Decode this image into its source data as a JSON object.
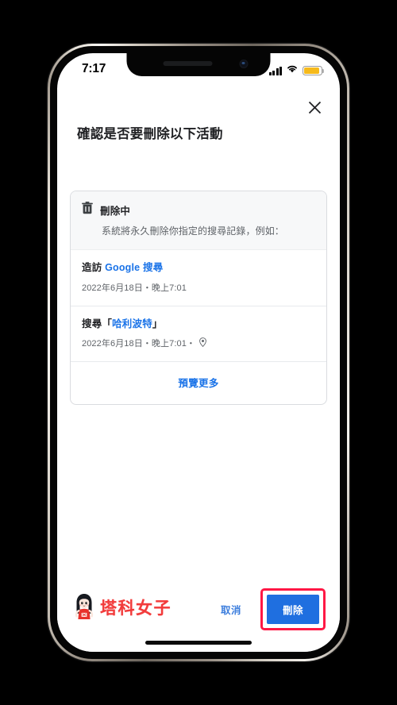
{
  "status_bar": {
    "time": "7:17",
    "signal_icon": "cellular-signal-icon",
    "wifi_icon": "wifi-icon",
    "battery_icon": "battery-icon",
    "battery_color": "#f6ba1c"
  },
  "header": {
    "close_icon": "close-icon",
    "title": "確認是否要刪除以下活動"
  },
  "card": {
    "header": {
      "icon": "trash-icon",
      "title": "刪除中",
      "description": "系統將永久刪除你指定的搜尋記錄，例如："
    },
    "entries": [
      {
        "title_prefix": "造訪 ",
        "title_link": "Google 搜尋",
        "title_suffix": "",
        "meta": "2022年6月18日・晚上7:01",
        "has_location": false
      },
      {
        "title_prefix": "搜尋「",
        "title_link": "哈利波特",
        "title_suffix": "」",
        "meta": "2022年6月18日・晚上7:01・",
        "has_location": true,
        "location_icon": "map-pin-icon"
      }
    ],
    "footer_link": "預覽更多"
  },
  "actions": {
    "cancel_label": "取消",
    "delete_label": "刪除",
    "delete_button_color": "#1f6fe0",
    "highlight_color": "#ff1744",
    "link_color": "#1a73e8"
  },
  "watermark": {
    "mascot_icon": "mascot-girl-icon",
    "text": "塔科女子",
    "color": "#f23b3b"
  }
}
